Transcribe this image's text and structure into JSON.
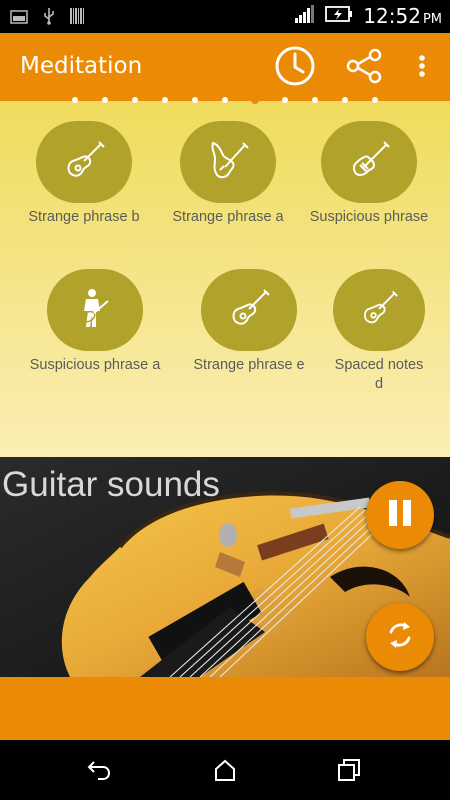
{
  "status_bar": {
    "time": "12:52",
    "ampm": "PM",
    "icons": [
      "image-icon",
      "usb-icon",
      "barcode-icon",
      "signal-icon",
      "battery-charging-icon"
    ]
  },
  "app_bar": {
    "title": "Meditation",
    "icons": [
      "clock-icon",
      "share-icon",
      "overflow-menu-icon"
    ]
  },
  "pager": {
    "page_count": 11,
    "active_index": 6
  },
  "tiles": [
    {
      "label": "Strange phrase b",
      "icon": "acoustic-guitar-icon"
    },
    {
      "label": "Strange phrase a",
      "icon": "electric-guitar-icon"
    },
    {
      "label": "Suspicious phrase",
      "icon": "electric-guitar-icon"
    },
    {
      "label": "Suspicious phrase a",
      "icon": "guitarist-icon"
    },
    {
      "label": "Strange phrase e",
      "icon": "acoustic-guitar-icon"
    },
    {
      "label": "Spaced notes d",
      "icon": "acoustic-guitar-icon"
    }
  ],
  "hero": {
    "title": "Guitar sounds",
    "pause_icon": "pause-icon",
    "refresh_icon": "refresh-icon"
  },
  "nav_bar": {
    "icons": [
      "back-icon",
      "home-icon",
      "recents-icon"
    ]
  },
  "colors": {
    "accent": "#ea8a05",
    "tile": "#b0a22a",
    "tile_label": "#5b5b5b"
  }
}
